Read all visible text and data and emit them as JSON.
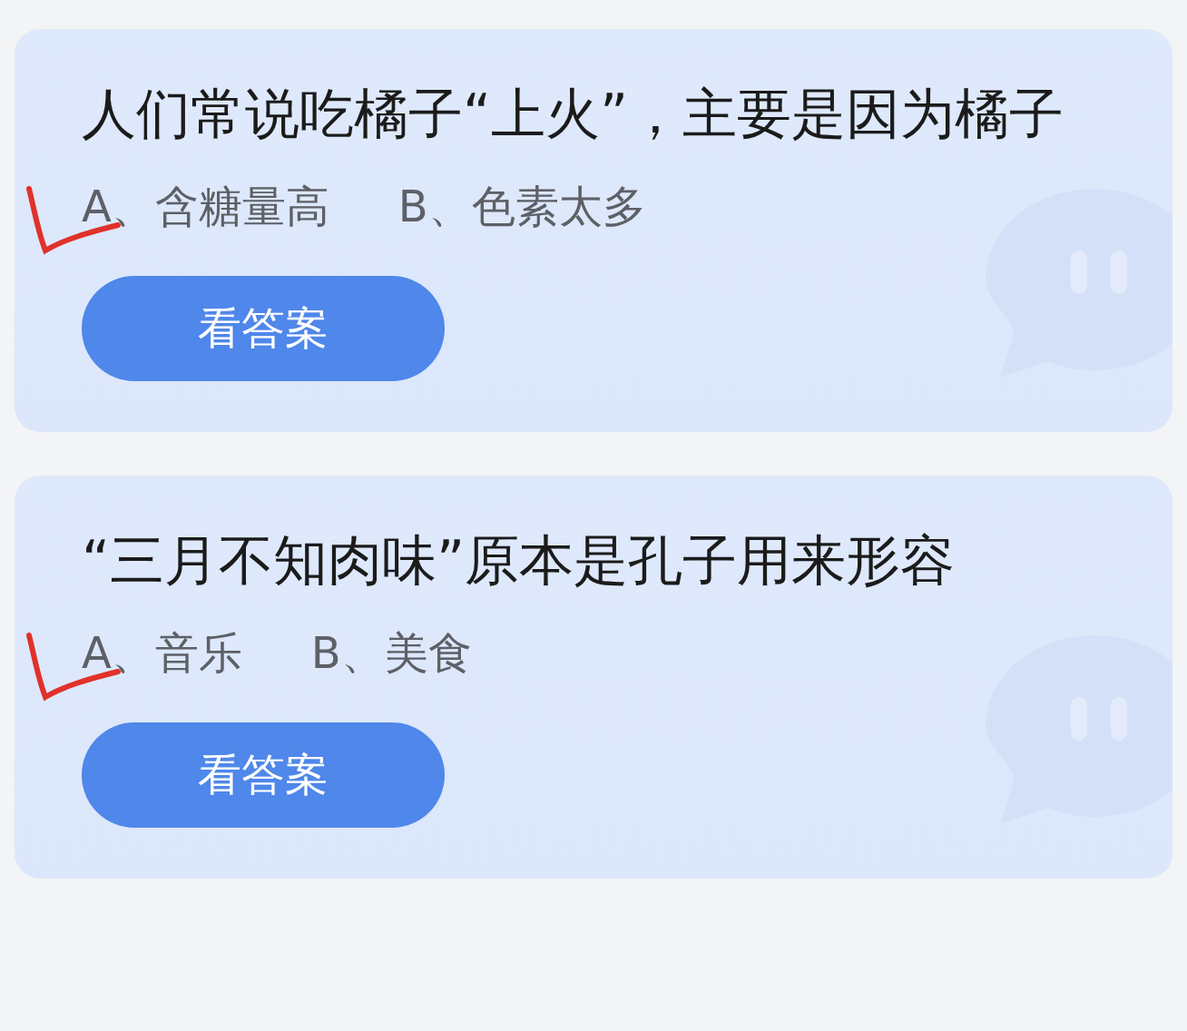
{
  "questions": [
    {
      "question": "人们常说吃橘子“上火”，主要是因为橘子",
      "options": [
        {
          "label": "A、含糖量高",
          "marked": true
        },
        {
          "label": "B、色素太多",
          "marked": false
        }
      ],
      "button": "看答案"
    },
    {
      "question": "“三月不知肉味”原本是孔子用来形容",
      "options": [
        {
          "label": "A、音乐",
          "marked": true
        },
        {
          "label": "B、美食",
          "marked": false
        }
      ],
      "button": "看答案"
    }
  ]
}
